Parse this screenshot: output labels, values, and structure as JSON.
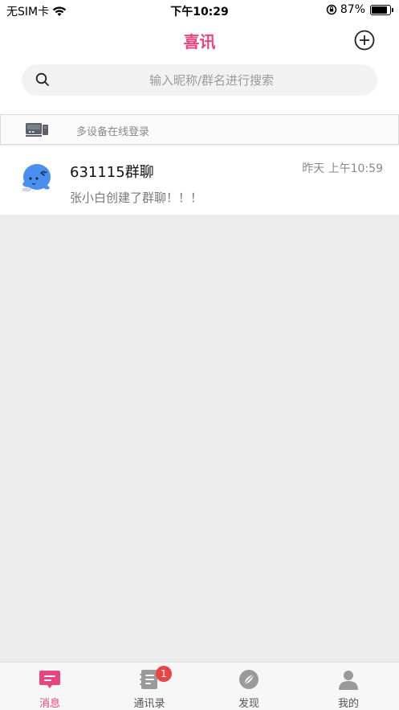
{
  "status_bar": {
    "carrier": "无SIM卡",
    "time": "下午10:29",
    "battery_percent": "87%",
    "battery_level": 0.87
  },
  "header": {
    "title": "喜讯",
    "add_icon": "plus-circle-icon"
  },
  "search": {
    "placeholder": "输入昵称/群名进行搜索"
  },
  "device_banner": {
    "text": "多设备在线登录",
    "icon": "devices-icon"
  },
  "chats": [
    {
      "name": "631115群聊",
      "time": "昨天 上午10:59",
      "preview": "张小白创建了群聊！！！",
      "avatar_icon": "group-avatar-icon"
    }
  ],
  "tabs": [
    {
      "label": "消息",
      "icon": "message-icon",
      "active": true
    },
    {
      "label": "通讯录",
      "icon": "contacts-icon",
      "badge": "1"
    },
    {
      "label": "发现",
      "icon": "discover-icon"
    },
    {
      "label": "我的",
      "icon": "profile-icon"
    }
  ],
  "colors": {
    "accent": "#e8447e",
    "avatar_blue": "#4a8ff0",
    "badge_red": "#e84545"
  }
}
